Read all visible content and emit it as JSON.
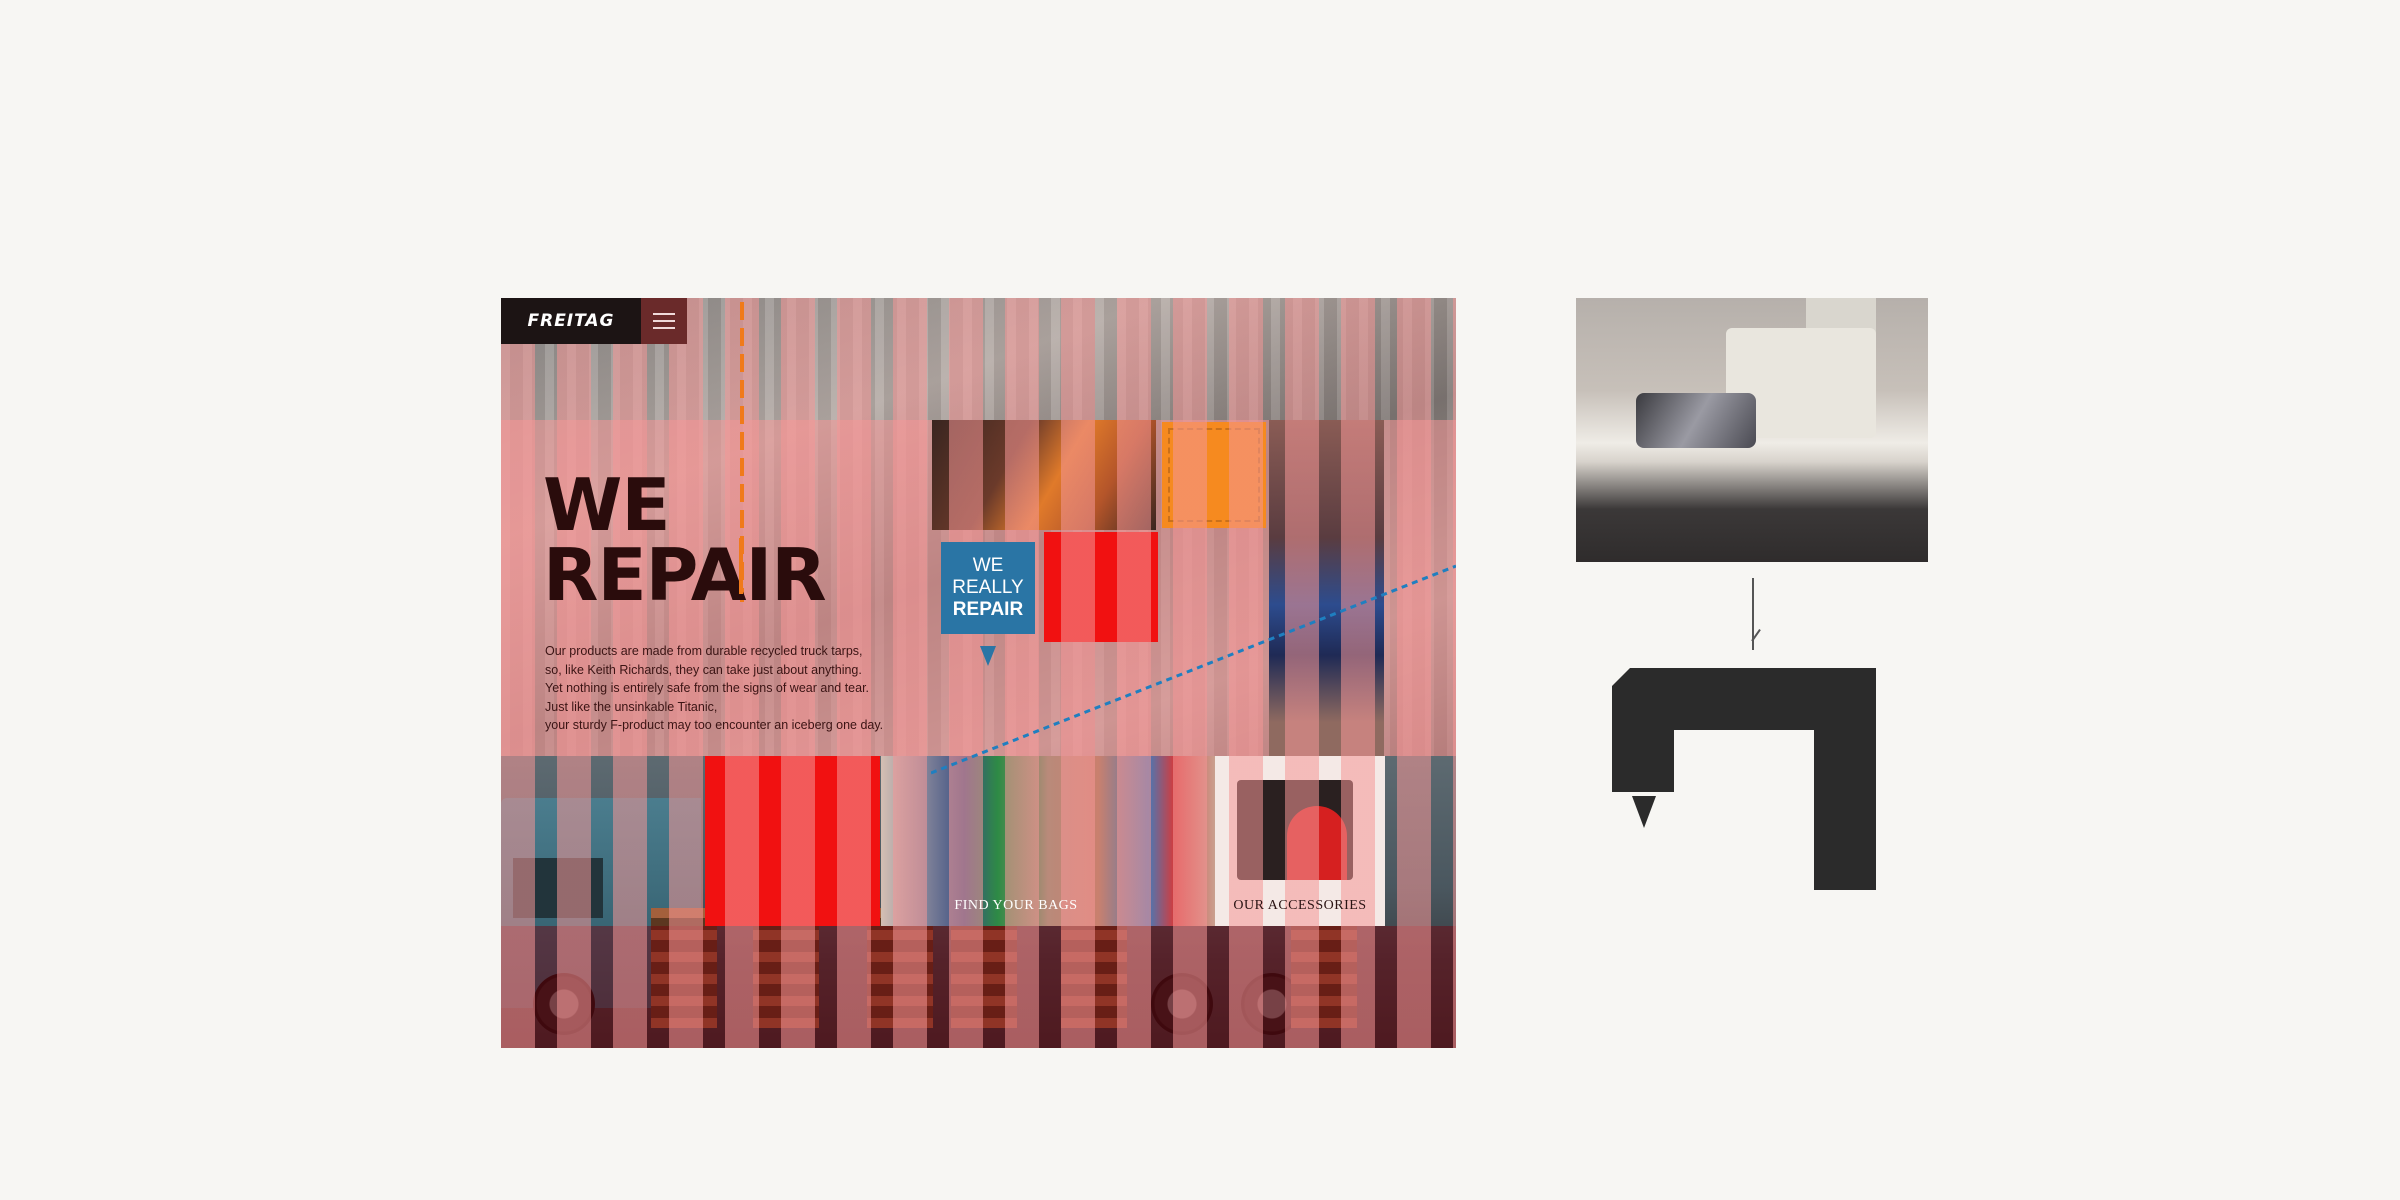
{
  "site": {
    "logo": "FREITAG",
    "menu_label": "menu",
    "headline_line1": "WE",
    "headline_line2": "REPAIR",
    "body_lines": [
      "Our products are made from durable recycled truck tarps,",
      "so, like Keith Richards, they can take just about anything.",
      "Yet nothing is entirely safe from the signs of wear and tear.",
      "Just like the unsinkable Titanic,",
      "your sturdy F-product may too encounter an iceberg one day."
    ],
    "badge": {
      "line1": "WE",
      "line2": "REALLY",
      "line3": "REPAIR"
    },
    "tile_bags_label": "FIND YOUR BAGS",
    "tile_accessories_label": "OUR ACCESSORIES"
  },
  "colors": {
    "accent_orange": "#f68a1f",
    "accent_red": "#f11111",
    "badge_blue": "#2a75a5",
    "stripe_pink": "#f49696",
    "diagram_dark": "#2b2b2b"
  },
  "icons": {
    "menu": "hamburger-icon",
    "badge_pointer": "triangle-down-icon",
    "diagram_pointer": "triangle-down-icon"
  }
}
